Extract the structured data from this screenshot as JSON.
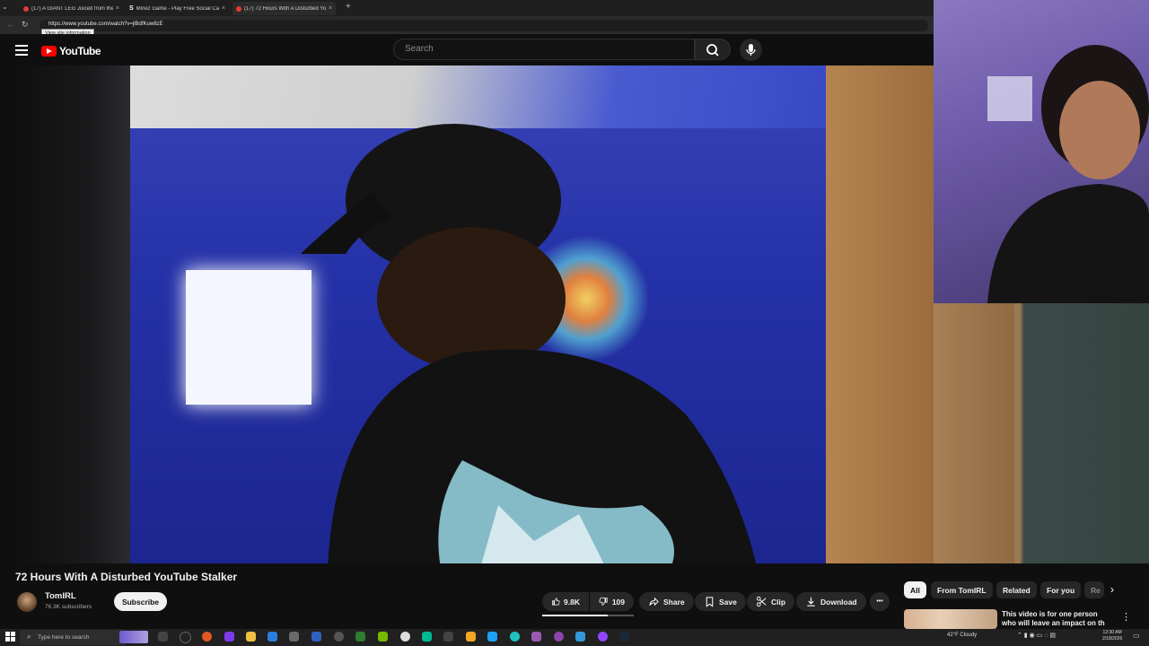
{
  "browser": {
    "tabs": [
      {
        "label": "(17) A GIANT LEG Juiced from the",
        "close": "×",
        "active": false
      },
      {
        "label": "Minez Game - Play Free Social Ca",
        "close": "×",
        "active": false
      },
      {
        "label": "(17) 72 Hours With A Disturbed Yo",
        "close": "×",
        "active": true
      }
    ],
    "new_tab": "+",
    "url": "https://www.youtube.com/watch?v=jlBdfKuw8zE",
    "tooltip": "View site information"
  },
  "header": {
    "logo_text": "YouTube",
    "search_placeholder": "Search",
    "icons": [
      "menu-icon",
      "search-icon",
      "mic-icon"
    ]
  },
  "video": {
    "title": "72 Hours With A Disturbed YouTube Stalker"
  },
  "channel": {
    "name": "TomIRL",
    "subscribers": "76.3K subscribers",
    "subscribe_label": "Subscribe"
  },
  "actions": {
    "likes": "9.8K",
    "dislikes": "109",
    "like_ratio": 0.72,
    "share": "Share",
    "save": "Save",
    "clip": "Clip",
    "download": "Download",
    "more": "•••"
  },
  "chips": [
    "All",
    "From TomIRL",
    "Related",
    "For you",
    "Re"
  ],
  "recommendation": {
    "title": "This video is for one person who will leave an impact on th"
  },
  "taskbar": {
    "search_placeholder": "Type here to search",
    "weather": "42°F  Cloudy",
    "time": "12:30 AM",
    "date": "2/18/2026"
  }
}
